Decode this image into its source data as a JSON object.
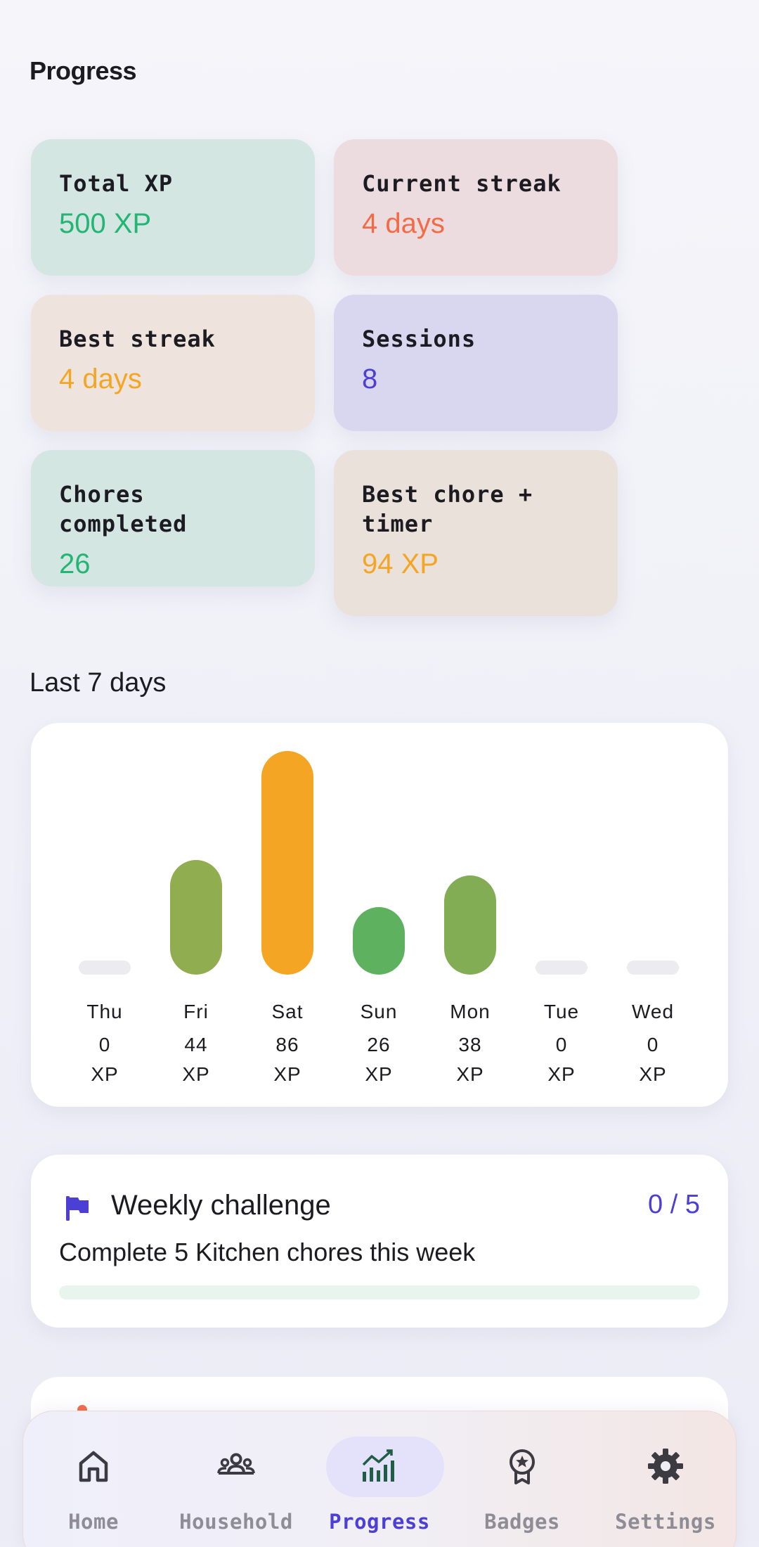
{
  "page": {
    "title": "Progress"
  },
  "stats": [
    {
      "label": "Total XP",
      "value": "500 XP",
      "color": "#22b573",
      "bg": "#d3e6e2"
    },
    {
      "label": "Current streak",
      "value": "4 days",
      "color": "#f26b47",
      "bg": "#ecdcdf"
    },
    {
      "label": "Best streak",
      "value": "4 days",
      "color": "#f5a524",
      "bg": "#eee4dd"
    },
    {
      "label": "Sessions",
      "value": "8",
      "color": "#4b3fd6",
      "bg": "#d9d7f0"
    },
    {
      "label": "Chores completed",
      "value": "26",
      "color": "#22b573",
      "bg": "#d3e6e2"
    },
    {
      "label": "Best chore + timer",
      "value": "94 XP",
      "color": "#f5a524",
      "bg": "#eae1db"
    }
  ],
  "weekly": {
    "title": "Last 7 days",
    "unit": "XP"
  },
  "chart_data": {
    "type": "bar",
    "categories": [
      "Thu",
      "Fri",
      "Sat",
      "Sun",
      "Mon",
      "Tue",
      "Wed"
    ],
    "values": [
      0,
      44,
      86,
      26,
      38,
      0,
      0
    ],
    "value_labels": [
      "0",
      "44",
      "86",
      "26",
      "38",
      "0",
      "0"
    ],
    "colors": [
      "#ebebf0",
      "#90ad50",
      "#f5a524",
      "#5db15f",
      "#82ad55",
      "#ebebf0",
      "#ebebf0"
    ],
    "title": "Last 7 days",
    "xlabel": "",
    "ylabel": "",
    "ylim": [
      0,
      86
    ],
    "grid": false
  },
  "challenge": {
    "title": "Weekly challenge",
    "count": "0 / 5",
    "progress": 0,
    "description": "Complete 5 Kitchen chores this week",
    "icon": "flag-icon",
    "accent": "#4b3fd6"
  },
  "nav": [
    {
      "label": "Home",
      "icon": "home-icon",
      "active": false
    },
    {
      "label": "Household",
      "icon": "household-icon",
      "active": false
    },
    {
      "label": "Progress",
      "icon": "progress-chart-icon",
      "active": true
    },
    {
      "label": "Badges",
      "icon": "badge-icon",
      "active": false
    },
    {
      "label": "Settings",
      "icon": "gear-icon",
      "active": false
    }
  ]
}
